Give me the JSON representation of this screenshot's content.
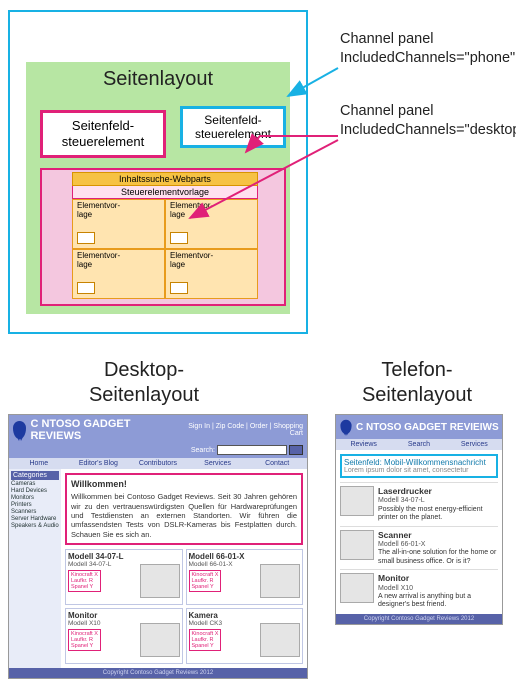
{
  "top": {
    "page_layout_label": "Seitenlayout",
    "field_ctrl_desktop": "Seitenfeld-\nsteuerelement",
    "field_ctrl_phone": "Seitenfeld-\nsteuerelement",
    "webparts_header": "Inhaltssuche-Webparts",
    "ctrl_template_label": "Steuerelementvorlage",
    "item_template_label": "Elementvor-\nlage"
  },
  "callouts": {
    "phone_line1": "Channel panel",
    "phone_line2": "IncludedChannels=\"phone\"",
    "desktop_line1": "Channel panel",
    "desktop_line2": "IncludedChannels=\"desktop\""
  },
  "sections": {
    "desktop_title": "Desktop-\nSeitenlayout",
    "phone_title": "Telefon-\nSeitenlayout"
  },
  "desktop": {
    "site_title": "C   NTOSO GADGET REVIEWS",
    "top_links": "Sign In  |  Zip Code  |  Order  |  Shopping Cart",
    "search_label": "Search:",
    "nav": [
      "Home",
      "Editor's Blog",
      "Contributors",
      "Services",
      "Contact"
    ],
    "categories_hdr": "Categories",
    "categories": [
      "Cameras",
      "Hard Devices",
      "Monitors",
      "Printers",
      "Scanners",
      "Server Hardware",
      "Speakers & Audio"
    ],
    "welcome_title": "Willkommen!",
    "welcome_body": "Willkommen bei Contoso Gadget Reviews. Seit 30 Jahren gehören wir zu den vertrauenswürdigsten Quellen für Hardwareprüfungen und Testdiensten an externen Standorten. Wir führen die umfassendsten Tests von DSLR-Kameras bis Festplatten durch. Schauen Sie es sich an.",
    "products": [
      {
        "title": "Modell 34-07-L",
        "model": "Modell 34-07-L"
      },
      {
        "title": "Modell 66-01-X",
        "model": "Modell 66-01-X"
      },
      {
        "title": "Monitor",
        "model": "Modell X10"
      },
      {
        "title": "Kamera",
        "model": "Modell CK3"
      }
    ],
    "pink_box": "Kinocraft X\nLaufkr. R\nSpanel Y",
    "footer": "Copyright Contoso Gadget Reviews 2012"
  },
  "phone": {
    "site_title": "C   NTOSO GADGET REVIEIWS",
    "nav": [
      "Reviews",
      "Search",
      "Services"
    ],
    "field_title": "Seitenfeld: Mobil-Willkommensnachricht",
    "field_body": "Lorem ipsum dolor sit amet, consectetur",
    "products": [
      {
        "title": "Laserdrucker",
        "model": "Modell 34-07-L",
        "desc": "Possibly the most energy-efficient printer on the planet."
      },
      {
        "title": "Scanner",
        "model": "Modell 66-01-X",
        "desc": "The all-in-one solution for the home or small business office. Or is it?"
      },
      {
        "title": "Monitor",
        "model": "Modell X10",
        "desc": "A new arrival is anything but a designer's best friend."
      }
    ],
    "footer": "Copyright Contoso Gadget Reviews 2012"
  }
}
